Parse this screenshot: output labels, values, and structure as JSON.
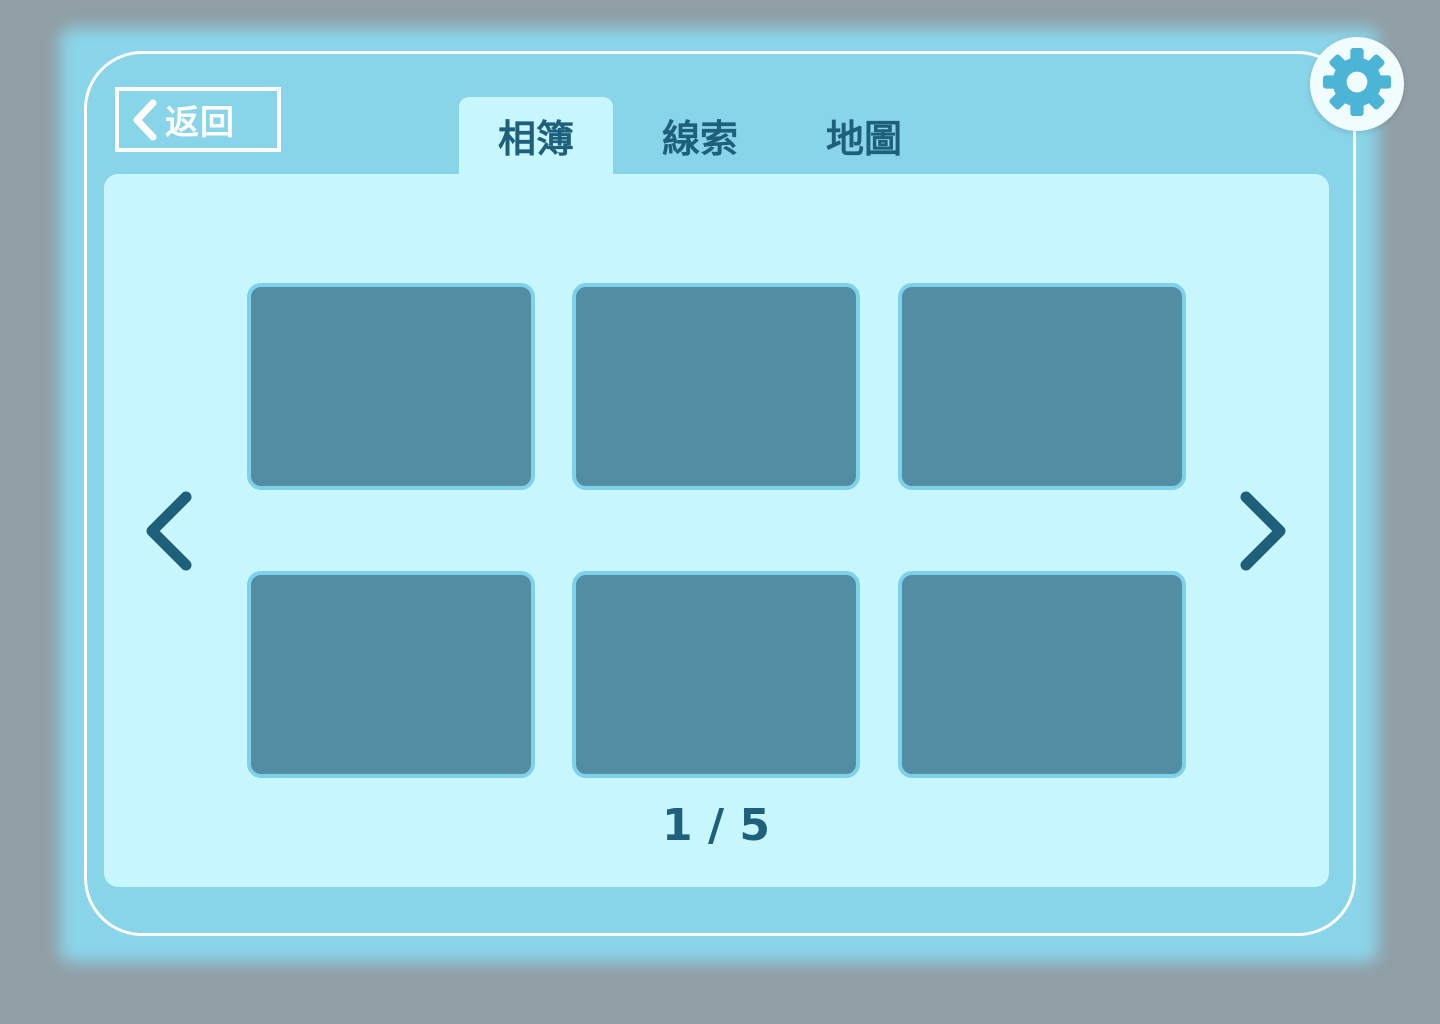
{
  "header": {
    "back_label": "返回",
    "back_icon": "chevron-left-icon",
    "settings_icon": "gear-icon"
  },
  "tabs": [
    {
      "label": "相簿",
      "active": true
    },
    {
      "label": "線索",
      "active": false
    },
    {
      "label": "地圖",
      "active": false
    }
  ],
  "album": {
    "thumbnail_count": 6,
    "prev_icon": "chevron-left-icon",
    "next_icon": "chevron-right-icon",
    "page_indicator": "1 / 5",
    "current_page": 1,
    "total_pages": 5
  },
  "colors": {
    "background": "#919fa6",
    "panel": "#88d4e9",
    "content": "#c8f6fe",
    "thumbnail": "#528da4",
    "accent_text": "#1e607c",
    "border": "#ffffff"
  }
}
